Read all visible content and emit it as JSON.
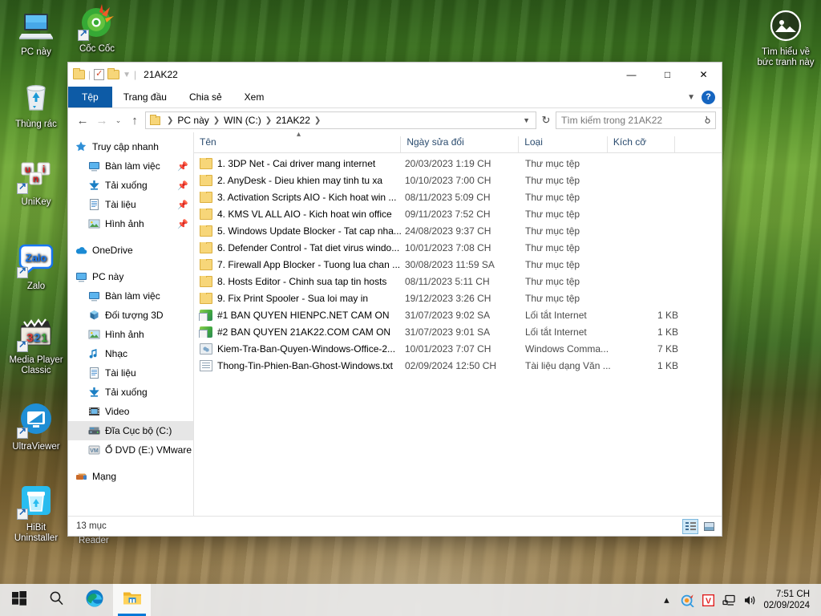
{
  "desktop": {
    "icons": [
      {
        "label": "PC này",
        "icon": "this-pc-icon",
        "shortcut": false
      },
      {
        "label": "Thùng rác",
        "icon": "recycle-bin-icon",
        "shortcut": false
      },
      {
        "label": "UniKey",
        "icon": "unikey-icon",
        "shortcut": true
      },
      {
        "label": "Zalo",
        "icon": "zalo-icon",
        "shortcut": true
      },
      {
        "label": "Media Player Classic",
        "icon": "media-player-classic-icon",
        "shortcut": true
      },
      {
        "label": "UltraViewer",
        "icon": "ultraviewer-icon",
        "shortcut": true
      },
      {
        "label": "HiBit Uninstaller",
        "icon": "hibit-uninstaller-icon",
        "shortcut": true
      },
      {
        "label": "Cốc Cốc",
        "icon": "coccoc-browser-icon",
        "shortcut": true
      }
    ],
    "spotlight": {
      "line1": "Tìm hiểu về",
      "line2": "bức tranh này",
      "icon": "spotlight-image-icon"
    },
    "reader_label": "Reader"
  },
  "window": {
    "title": "21AK22",
    "quick_access": [
      "folder-icon",
      "properties-icon",
      "new-folder-icon",
      "customize-dropdown-icon"
    ],
    "controls": {
      "minimize": "—",
      "maximize": "□",
      "close": "✕"
    },
    "ribbon": {
      "tabs": [
        {
          "label": "Tệp",
          "active": true
        },
        {
          "label": "Trang đầu",
          "active": false
        },
        {
          "label": "Chia sẻ",
          "active": false
        },
        {
          "label": "Xem",
          "active": false
        }
      ],
      "collapse_icon": "chevron-down-icon",
      "help_label": "?"
    },
    "address": {
      "back_icon": "←",
      "forward_icon": "→",
      "recent_icon": "⌄",
      "up_icon": "↑",
      "crumbs": [
        "PC này",
        "WIN (C:)",
        "21AK22"
      ],
      "dropdown_icon": "⌄",
      "refresh_icon": "↻",
      "search_placeholder": "Tìm kiếm trong 21AK22",
      "search_icon": "search-icon"
    },
    "statusbar": {
      "count": "13 mục",
      "view_details": "details-view-icon",
      "view_large": "large-icons-view-icon"
    }
  },
  "sidebar": {
    "items": [
      {
        "label": "Truy cập nhanh",
        "icon": "quick-access-star-icon",
        "level": 0,
        "pin": false,
        "selected": false
      },
      {
        "label": "Bàn làm việc",
        "icon": "desktop-icon",
        "level": 1,
        "pin": true,
        "selected": false
      },
      {
        "label": "Tải xuống",
        "icon": "downloads-icon",
        "level": 1,
        "pin": true,
        "selected": false
      },
      {
        "label": "Tài liệu",
        "icon": "documents-icon",
        "level": 1,
        "pin": true,
        "selected": false
      },
      {
        "label": "Hình ảnh",
        "icon": "pictures-icon",
        "level": 1,
        "pin": true,
        "selected": false
      },
      {
        "label": "OneDrive",
        "icon": "onedrive-cloud-icon",
        "level": 0,
        "pin": false,
        "selected": false
      },
      {
        "label": "PC này",
        "icon": "this-pc-icon",
        "level": 0,
        "pin": false,
        "selected": false
      },
      {
        "label": "Bàn làm việc",
        "icon": "desktop-icon",
        "level": 1,
        "pin": false,
        "selected": false
      },
      {
        "label": "Đối tượng 3D",
        "icon": "3d-objects-icon",
        "level": 1,
        "pin": false,
        "selected": false
      },
      {
        "label": "Hình ảnh",
        "icon": "pictures-icon",
        "level": 1,
        "pin": false,
        "selected": false
      },
      {
        "label": "Nhạc",
        "icon": "music-note-icon",
        "level": 1,
        "pin": false,
        "selected": false
      },
      {
        "label": "Tài liệu",
        "icon": "documents-icon",
        "level": 1,
        "pin": false,
        "selected": false
      },
      {
        "label": "Tải xuống",
        "icon": "downloads-icon",
        "level": 1,
        "pin": false,
        "selected": false
      },
      {
        "label": "Video",
        "icon": "videos-icon",
        "level": 1,
        "pin": false,
        "selected": false
      },
      {
        "label": "Đĩa Cục bộ (C:)",
        "icon": "local-disk-icon",
        "level": 1,
        "pin": false,
        "selected": true
      },
      {
        "label": "Ổ DVD (E:) VMware",
        "icon": "dvd-drive-icon",
        "level": 1,
        "pin": false,
        "selected": false
      },
      {
        "label": "Mạng",
        "icon": "network-icon",
        "level": 0,
        "pin": false,
        "selected": false
      }
    ]
  },
  "filelist": {
    "columns": [
      {
        "label": "Tên",
        "sorted": true,
        "sort_dir": "asc"
      },
      {
        "label": "Ngày sửa đổi",
        "sorted": false
      },
      {
        "label": "Loại",
        "sorted": false
      },
      {
        "label": "Kích cỡ",
        "sorted": false
      }
    ],
    "rows": [
      {
        "name": "1. 3DP Net - Cai driver mang internet",
        "date": "20/03/2023 1:19 CH",
        "type": "Thư mục tệp",
        "size": "",
        "icon": "folder"
      },
      {
        "name": "2. AnyDesk - Dieu khien may tinh tu xa",
        "date": "10/10/2023 7:00 CH",
        "type": "Thư mục tệp",
        "size": "",
        "icon": "folder"
      },
      {
        "name": "3. Activation Scripts AIO - Kich hoat win ...",
        "date": "08/11/2023 5:09 CH",
        "type": "Thư mục tệp",
        "size": "",
        "icon": "folder"
      },
      {
        "name": "4. KMS VL ALL AIO - Kich hoat win office",
        "date": "09/11/2023 7:52 CH",
        "type": "Thư mục tệp",
        "size": "",
        "icon": "folder"
      },
      {
        "name": "5. Windows Update Blocker - Tat cap nha...",
        "date": "24/08/2023 9:37 CH",
        "type": "Thư mục tệp",
        "size": "",
        "icon": "folder"
      },
      {
        "name": "6. Defender Control - Tat diet virus windo...",
        "date": "10/01/2023 7:08 CH",
        "type": "Thư mục tệp",
        "size": "",
        "icon": "folder"
      },
      {
        "name": "7. Firewall App Blocker - Tuong lua chan ...",
        "date": "30/08/2023 11:59 SA",
        "type": "Thư mục tệp",
        "size": "",
        "icon": "folder"
      },
      {
        "name": "8. Hosts Editor - Chinh sua tap tin hosts",
        "date": "08/11/2023 5:11 CH",
        "type": "Thư mục tệp",
        "size": "",
        "icon": "folder"
      },
      {
        "name": "9. Fix Print Spooler - Sua loi may in",
        "date": "19/12/2023 3:26 CH",
        "type": "Thư mục tệp",
        "size": "",
        "icon": "folder"
      },
      {
        "name": "#1 BAN QUYEN HIENPC.NET CAM ON",
        "date": "31/07/2023 9:02 SA",
        "type": "Lối tắt Internet",
        "size": "1 KB",
        "icon": "url"
      },
      {
        "name": "#2 BAN QUYEN 21AK22.COM CAM ON",
        "date": "31/07/2023 9:01 SA",
        "type": "Lối tắt Internet",
        "size": "1 KB",
        "icon": "url"
      },
      {
        "name": "Kiem-Tra-Ban-Quyen-Windows-Office-2...",
        "date": "10/01/2023 7:07 CH",
        "type": "Windows Comma...",
        "size": "7 KB",
        "icon": "cmd"
      },
      {
        "name": "Thong-Tin-Phien-Ban-Ghost-Windows.txt",
        "date": "02/09/2024 12:50 CH",
        "type": "Tài liệu dạng Văn ...",
        "size": "1 KB",
        "icon": "txt"
      }
    ]
  },
  "taskbar": {
    "buttons": [
      {
        "name": "start-button",
        "icon": "windows-logo-icon",
        "active": false
      },
      {
        "name": "search-button",
        "icon": "search-icon",
        "active": false
      },
      {
        "name": "edge-button",
        "icon": "microsoft-edge-icon",
        "active": false
      },
      {
        "name": "file-explorer-button",
        "icon": "file-explorer-icon",
        "active": true
      }
    ],
    "tray": [
      {
        "name": "show-hidden-icons",
        "icon": "chevron-up-icon"
      },
      {
        "name": "coccoc-tray-icon",
        "icon": "coccoc-search-icon"
      },
      {
        "name": "unikey-tray-icon",
        "icon": "unikey-v-icon"
      },
      {
        "name": "network-tray-icon",
        "icon": "network-icon"
      },
      {
        "name": "volume-tray-icon",
        "icon": "speaker-icon"
      }
    ],
    "clock": {
      "time": "7:51 CH",
      "date": "02/09/2024"
    }
  },
  "colors": {
    "accent": "#0078d7",
    "file_tab": "#0d5ba6",
    "selection": "#e6e6e6",
    "hover": "#e5f3fb",
    "folder_yellow": "#f7d679",
    "column_header_text": "#2a4b6e"
  }
}
